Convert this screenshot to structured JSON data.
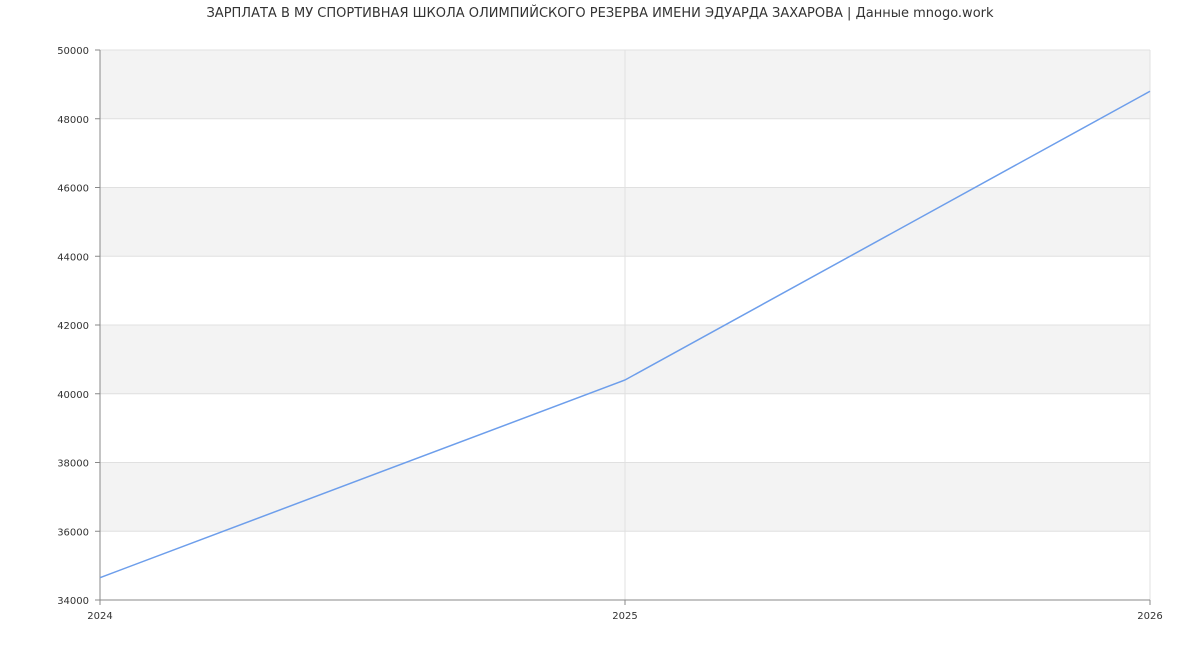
{
  "chart_data": {
    "type": "line",
    "title": "ЗАРПЛАТА В МУ  СПОРТИВНАЯ ШКОЛА ОЛИМПИЙСКОГО РЕЗЕРВА ИМЕНИ ЭДУАРДА ЗАХАРОВА | Данные mnogo.work",
    "xlabel": "",
    "ylabel": "",
    "x": [
      2024,
      2025,
      2026
    ],
    "xlim": [
      2024,
      2026
    ],
    "ylim": [
      34000,
      50000
    ],
    "x_ticks": [
      "2024",
      "2025",
      "2026"
    ],
    "y_ticks": [
      "34000",
      "36000",
      "38000",
      "40000",
      "42000",
      "44000",
      "46000",
      "48000",
      "50000"
    ],
    "series": [
      {
        "values": [
          34650,
          40400,
          48800
        ],
        "color": "#6d9eeb"
      }
    ],
    "grid": true,
    "band_colors": [
      "#ffffff",
      "#f3f3f3"
    ],
    "axis_color": "#888888",
    "grid_color": "#e0e0e0"
  }
}
